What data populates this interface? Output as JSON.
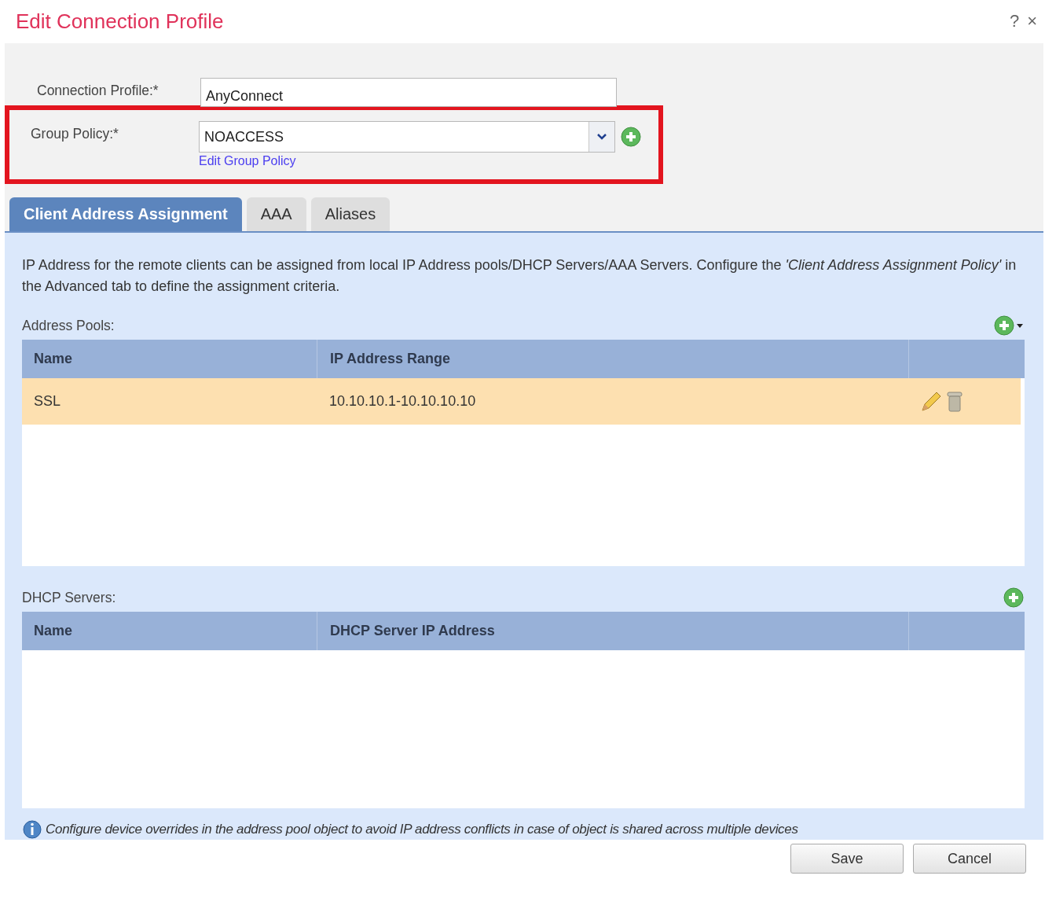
{
  "window": {
    "title": "Edit Connection Profile",
    "help": "?",
    "close": "×"
  },
  "form": {
    "connection_profile": {
      "label": "Connection Profile:*",
      "value": "AnyConnect"
    },
    "group_policy": {
      "label": "Group Policy:*",
      "value": "NOACCESS",
      "link": "Edit Group Policy"
    }
  },
  "tabs": [
    {
      "label": "Client Address Assignment",
      "selected": true
    },
    {
      "label": "AAA",
      "selected": false
    },
    {
      "label": "Aliases",
      "selected": false
    }
  ],
  "description": "IP Address for the remote clients can be assigned from local IP Address pools/DHCP Servers/AAA Servers. Configure the *'Client Address Assignment Policy'* in the Advanced tab to define the assignment criteria.",
  "address_pools": {
    "label": "Address Pools:",
    "columns": [
      "Name",
      "IP Address Range"
    ],
    "rows": [
      {
        "cells": [
          "SSL",
          "10.10.10.1-10.10.10.10"
        ],
        "selected": true
      }
    ]
  },
  "dhcp_servers": {
    "label": "DHCP Servers:",
    "columns": [
      "Name",
      "DHCP Server IP Address"
    ]
  },
  "note": "Configure device overrides in the address pool object to avoid IP address conflicts in case of object is shared across multiple devices",
  "buttons": [
    "Save",
    "Cancel"
  ]
}
